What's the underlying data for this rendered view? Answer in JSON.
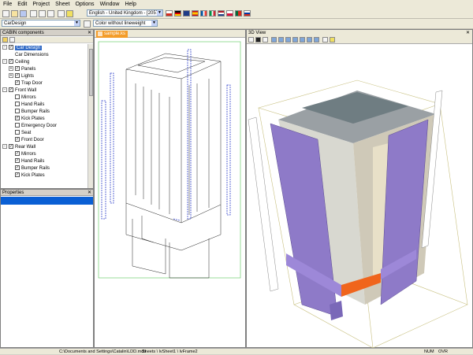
{
  "menu": [
    "File",
    "Edit",
    "Project",
    "Sheet",
    "Options",
    "Window",
    "Help"
  ],
  "toolbar": {
    "language": "English - United Kingdom - [2057]",
    "component": "CarDesign",
    "render_mode": "Color without lineweight"
  },
  "cabin_panel": {
    "title": "CABIN components",
    "tree": [
      {
        "label": "Car Design",
        "level": 0,
        "checked": true,
        "expander": "-",
        "selected": true
      },
      {
        "label": "Car Dimensions",
        "level": 1,
        "checked": null,
        "expander": null
      },
      {
        "label": "Ceiling",
        "level": 0,
        "checked": true,
        "expander": "-"
      },
      {
        "label": "Panels",
        "level": 1,
        "checked": true,
        "expander": "+"
      },
      {
        "label": "Lights",
        "level": 1,
        "checked": true,
        "expander": "+"
      },
      {
        "label": "Trap Door",
        "level": 1,
        "checked": true,
        "expander": null
      },
      {
        "label": "Front Wall",
        "level": 0,
        "checked": true,
        "expander": "-"
      },
      {
        "label": "Mirrors",
        "level": 1,
        "checked": false,
        "expander": null
      },
      {
        "label": "Hand Rails",
        "level": 1,
        "checked": false,
        "expander": null
      },
      {
        "label": "Bumper Rails",
        "level": 1,
        "checked": false,
        "expander": null
      },
      {
        "label": "Kick Plates",
        "level": 1,
        "checked": true,
        "expander": null
      },
      {
        "label": "Emergency Door",
        "level": 1,
        "checked": false,
        "expander": null
      },
      {
        "label": "Seat",
        "level": 1,
        "checked": false,
        "expander": null
      },
      {
        "label": "Front Door",
        "level": 1,
        "checked": true,
        "expander": null
      },
      {
        "label": "Rear Wall",
        "level": 0,
        "checked": true,
        "expander": "-"
      },
      {
        "label": "Mirrors",
        "level": 1,
        "checked": true,
        "expander": null
      },
      {
        "label": "Hand Rails",
        "level": 1,
        "checked": true,
        "expander": null
      },
      {
        "label": "Bumper Rails",
        "level": 1,
        "checked": true,
        "expander": null
      },
      {
        "label": "Kick Plates",
        "level": 1,
        "checked": true,
        "expander": null
      }
    ]
  },
  "properties_panel": {
    "title": "Properties"
  },
  "sheet_tab": {
    "label": "sample.ks"
  },
  "view3d": {
    "title": "3D View"
  },
  "statusbar": {
    "path": "C:\\Documents and Settings\\Catalin\\LDD.mdb",
    "sheet_path": "Sheets \\ lvSheet1 \\ lvFrame2",
    "num": "NUM",
    "ovr": "OVR"
  },
  "colors": {
    "accent": "#0a246a",
    "purple": "#8e7ac8",
    "selected": "#316ac5",
    "dashed_blue": "#3344cc"
  }
}
